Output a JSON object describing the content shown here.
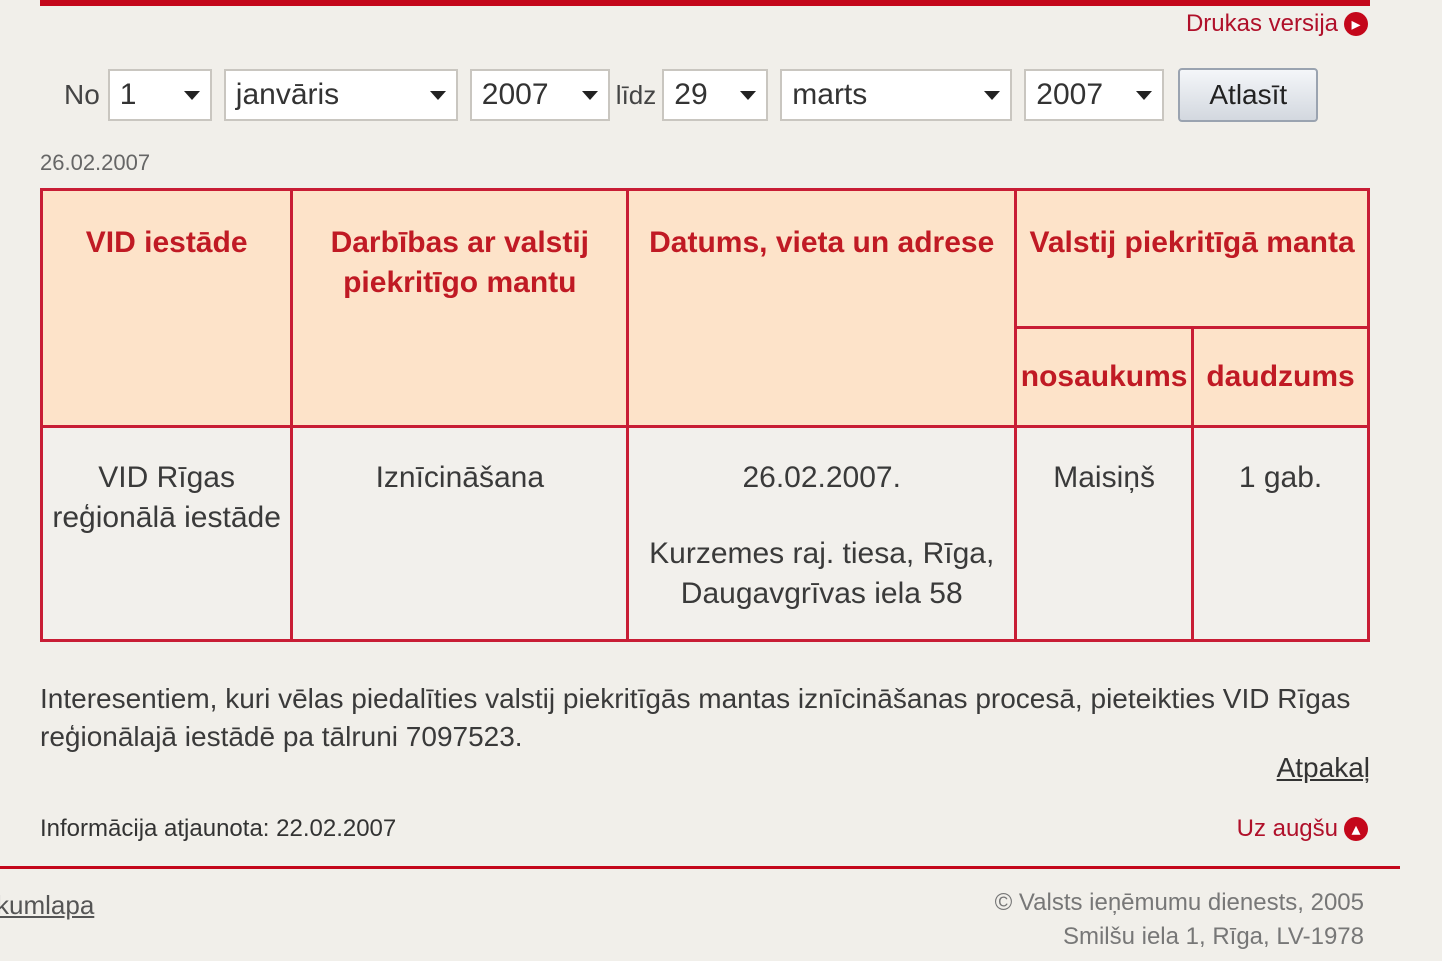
{
  "header": {
    "print_label": "Drukas versija",
    "brand_color": "#c4071b"
  },
  "filter": {
    "from_label": "No",
    "from_day": "1",
    "from_month": "janvāris",
    "from_year": "2007",
    "to_label": "līdz",
    "to_day": "29",
    "to_month": "marts",
    "to_year": "2007",
    "submit_label": "Atlasīt"
  },
  "record_date": "26.02.2007",
  "table": {
    "headers": {
      "vid": "VID iestāde",
      "actions": "Darbības ar valstij piekritīgo mantu",
      "date_place": "Datums, vieta un adrese",
      "property": "Valstij piekritīgā manta",
      "name": "nosaukums",
      "quantity": "daudzums"
    },
    "row": {
      "vid": "VID Rīgas reģionālā iestāde",
      "action": "Iznīcināšana",
      "date": "26.02.2007.",
      "place": "Kurzemes raj. tiesa, Rīga, Daugavgrīvas iela 58",
      "name": "Maisiņš",
      "quantity": "1 gab."
    }
  },
  "info_text": "Interesentiem, kuri vēlas piedalīties valstij piekritīgās mantas iznīcināšanas procesā, pieteikties VID Rīgas reģionālajā iestādē pa tālruni 7097523.",
  "back_label": "Atpakaļ",
  "updated_text": "Informācija atjaunota: 22.02.2007",
  "up_label": "Uz augšu",
  "footer": {
    "home_label": "kumlapa",
    "copyright": "© Valsts ieņēmumu dienests, 2005",
    "address": "Smilšu iela 1, Rīga, LV-1978"
  }
}
